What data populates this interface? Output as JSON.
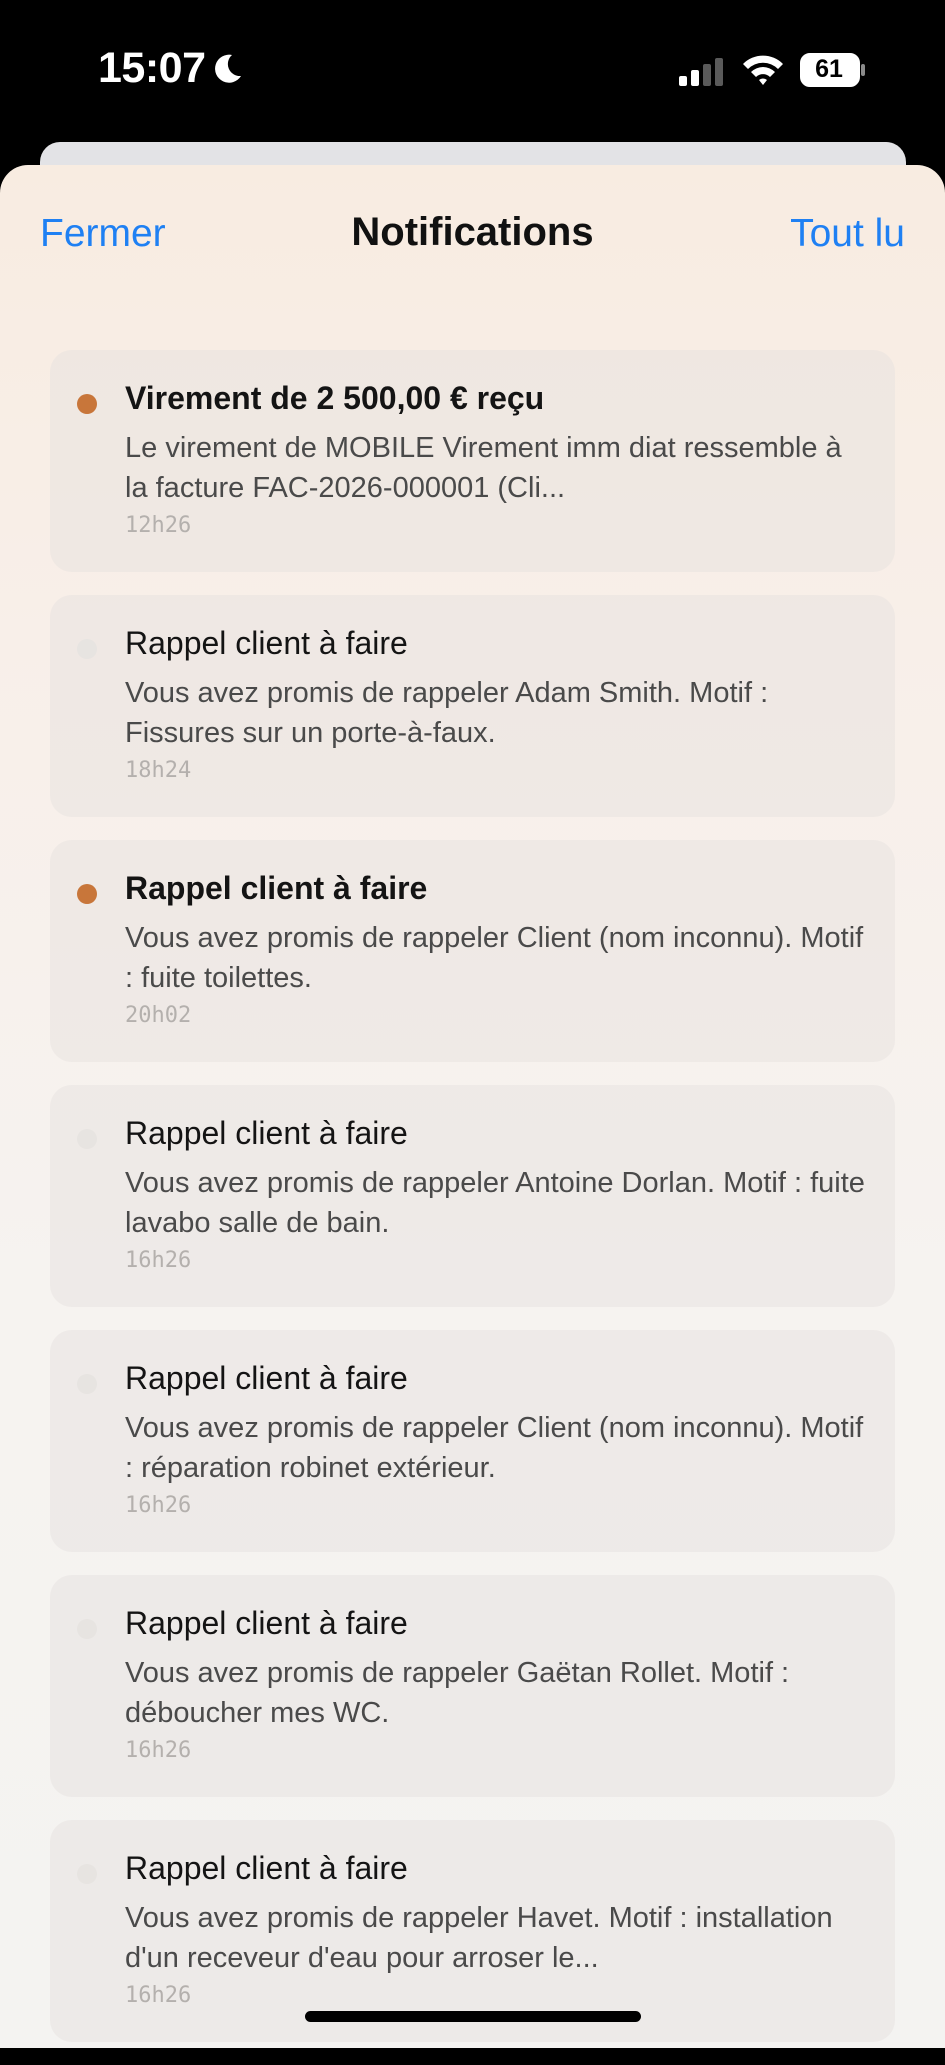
{
  "status_bar": {
    "time": "15:07",
    "battery": "61",
    "icons": [
      "moon-icon",
      "cellular-signal-icon",
      "wifi-icon",
      "battery-icon"
    ]
  },
  "header": {
    "close_label": "Fermer",
    "title": "Notifications",
    "mark_all_read_label": "Tout lu"
  },
  "colors": {
    "accent": "#1f80f3",
    "unread_dot": "#c8763a",
    "read_dot": "#e7e4e1"
  },
  "notifications": [
    {
      "title": "Virement de 2 500,00 € reçu",
      "body": "Le virement de MOBILE   Virement imm diat ressemble à la facture FAC-2026-000001 (Cli...",
      "time": "12h26",
      "unread": true
    },
    {
      "title": "Rappel client à faire",
      "body": "Vous avez promis de rappeler Adam Smith. Motif : Fissures sur un porte-à-faux.",
      "time": "18h24",
      "unread": false
    },
    {
      "title": "Rappel client à faire",
      "body": "Vous avez promis de rappeler Client (nom inconnu). Motif : fuite toilettes.",
      "time": "20h02",
      "unread": true
    },
    {
      "title": "Rappel client à faire",
      "body": "Vous avez promis de rappeler Antoine Dorlan. Motif : fuite lavabo salle de bain.",
      "time": "16h26",
      "unread": false
    },
    {
      "title": "Rappel client à faire",
      "body": "Vous avez promis de rappeler Client (nom inconnu). Motif : réparation robinet extérieur.",
      "time": "16h26",
      "unread": false
    },
    {
      "title": "Rappel client à faire",
      "body": "Vous avez promis de rappeler Gaëtan Rollet. Motif : déboucher mes WC.",
      "time": "16h26",
      "unread": false
    },
    {
      "title": "Rappel client à faire",
      "body": "Vous avez promis de rappeler Havet. Motif : installation d'un receveur d'eau pour arroser le...",
      "time": "16h26",
      "unread": false
    }
  ]
}
